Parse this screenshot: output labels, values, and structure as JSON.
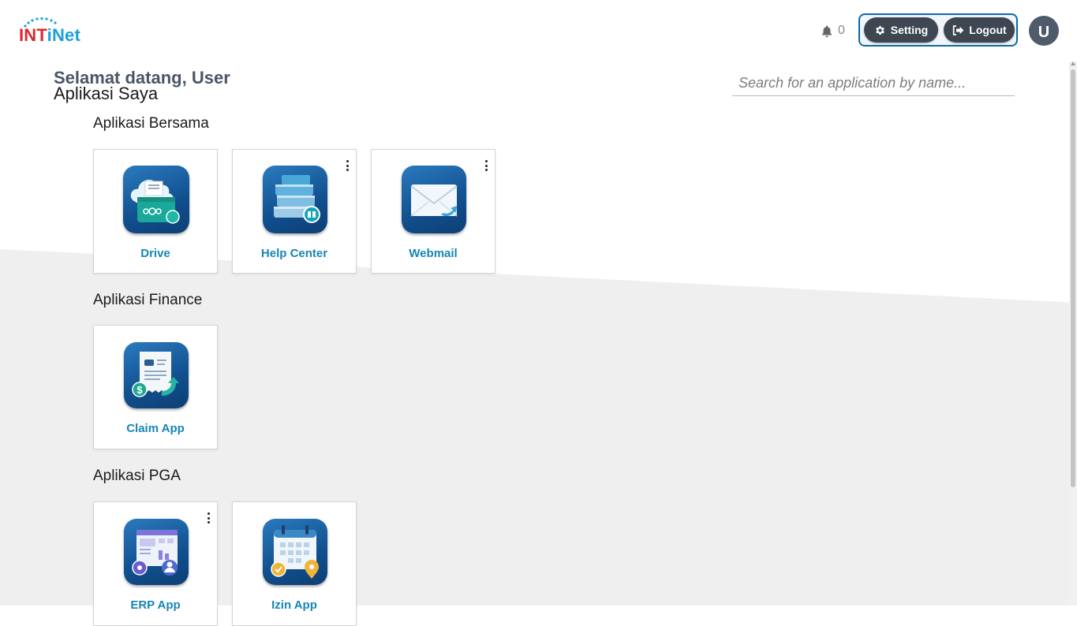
{
  "brand": {
    "logo_main": "INT",
    "logo_accent": "iNet"
  },
  "header": {
    "notification_count": "0",
    "setting_label": "Setting",
    "logout_label": "Logout",
    "avatar_initial": "U"
  },
  "main": {
    "welcome": "Selamat datang, User",
    "title": "Aplikasi Saya",
    "search_placeholder": "Search for an application by name...",
    "sections": [
      {
        "title": "Aplikasi Bersama",
        "apps": [
          {
            "label": "Drive",
            "icon": "drive-icon",
            "has_menu": false
          },
          {
            "label": "Help Center",
            "icon": "help-center-icon",
            "has_menu": true
          },
          {
            "label": "Webmail",
            "icon": "mail-icon",
            "has_menu": true
          }
        ]
      },
      {
        "title": "Aplikasi Finance",
        "apps": [
          {
            "label": "Claim App",
            "icon": "claim-icon",
            "has_menu": false
          }
        ]
      },
      {
        "title": "Aplikasi PGA",
        "apps": [
          {
            "label": "ERP App",
            "icon": "erp-icon",
            "has_menu": true
          },
          {
            "label": "Izin App",
            "icon": "calendar-icon",
            "has_menu": false
          }
        ]
      }
    ]
  },
  "colors": {
    "accent": "#1686b5",
    "brand_red": "#e0262d",
    "brand_blue": "#1ba0dc",
    "button_dark": "#3e4652",
    "group_border": "#0c6aa6"
  }
}
